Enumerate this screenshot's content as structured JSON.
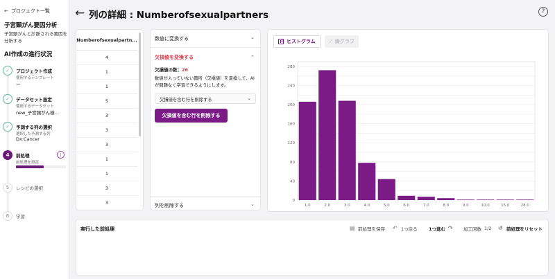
{
  "sidebar": {
    "back_label": "プロジェクト一覧",
    "project_title": "子宮頸がん要因分析",
    "project_desc": "子宮頸がんと診断される要因を分析する",
    "progress_title": "AI作成の進行状況",
    "steps": [
      {
        "num": "✓",
        "title": "プロジェクト作成",
        "sub": "使用するテンプレート",
        "value": "ー"
      },
      {
        "num": "✓",
        "title": "データセット設定",
        "sub": "使用するデータセット",
        "value": "new_子宮頸がん検..."
      },
      {
        "num": "✓",
        "title": "予測する列の選択",
        "sub": "選択した予測する列",
        "value": "Dx:Cancer"
      },
      {
        "num": "4",
        "title": "前処理",
        "sub": "前処理を設定"
      },
      {
        "num": "5",
        "title": "レシピの選択"
      },
      {
        "num": "6",
        "title": "学習"
      }
    ]
  },
  "header": {
    "back_arrow": "←",
    "title": "列の詳細 : Numberofsexualpartners",
    "help": "?"
  },
  "table": {
    "column": "Numberofsexualpartn...",
    "rows": [
      "4",
      "1",
      "1",
      "5",
      "3",
      "3",
      "3",
      "1",
      "1",
      "3",
      "3"
    ]
  },
  "processing": {
    "convert_numeric": "数値に変換する",
    "convert_missing": "欠損値を変換する",
    "missing_label": "欠損値の数：",
    "missing_count": "26",
    "description": "数値が入っていない箇所（欠損値）を変換して、AIが問題なく学習できるようにします。",
    "select_value": "欠損値を含む行を削除する",
    "apply_button": "欠損値を含む行を削除する",
    "delete_column": "列を削除する"
  },
  "chart_tabs": {
    "histogram": "ヒストグラム",
    "line": "線グラフ"
  },
  "chart_data": {
    "type": "bar",
    "categories": [
      "1.0",
      "2.0",
      "3.0",
      "4.0",
      "5.0",
      "6.0",
      "7.0",
      "8.0",
      "9.0",
      "10.0",
      "15.0",
      "28.0"
    ],
    "values": [
      206,
      272,
      208,
      78,
      44,
      9,
      7,
      4,
      1,
      1,
      1,
      1
    ],
    "ylim": [
      0,
      290
    ],
    "yticks": [
      0,
      20,
      40,
      60,
      80,
      100,
      120,
      140,
      160,
      180,
      200,
      220,
      240,
      260,
      280
    ],
    "color": "#7a1b86",
    "grid": true
  },
  "bottom": {
    "title": "実行した前処理",
    "save": "前処理を保存",
    "undo": "1つ戻る",
    "redo": "1つ進む",
    "count_label": "加工回数",
    "count_value": "1/2",
    "reset": "前処理をリセット"
  }
}
